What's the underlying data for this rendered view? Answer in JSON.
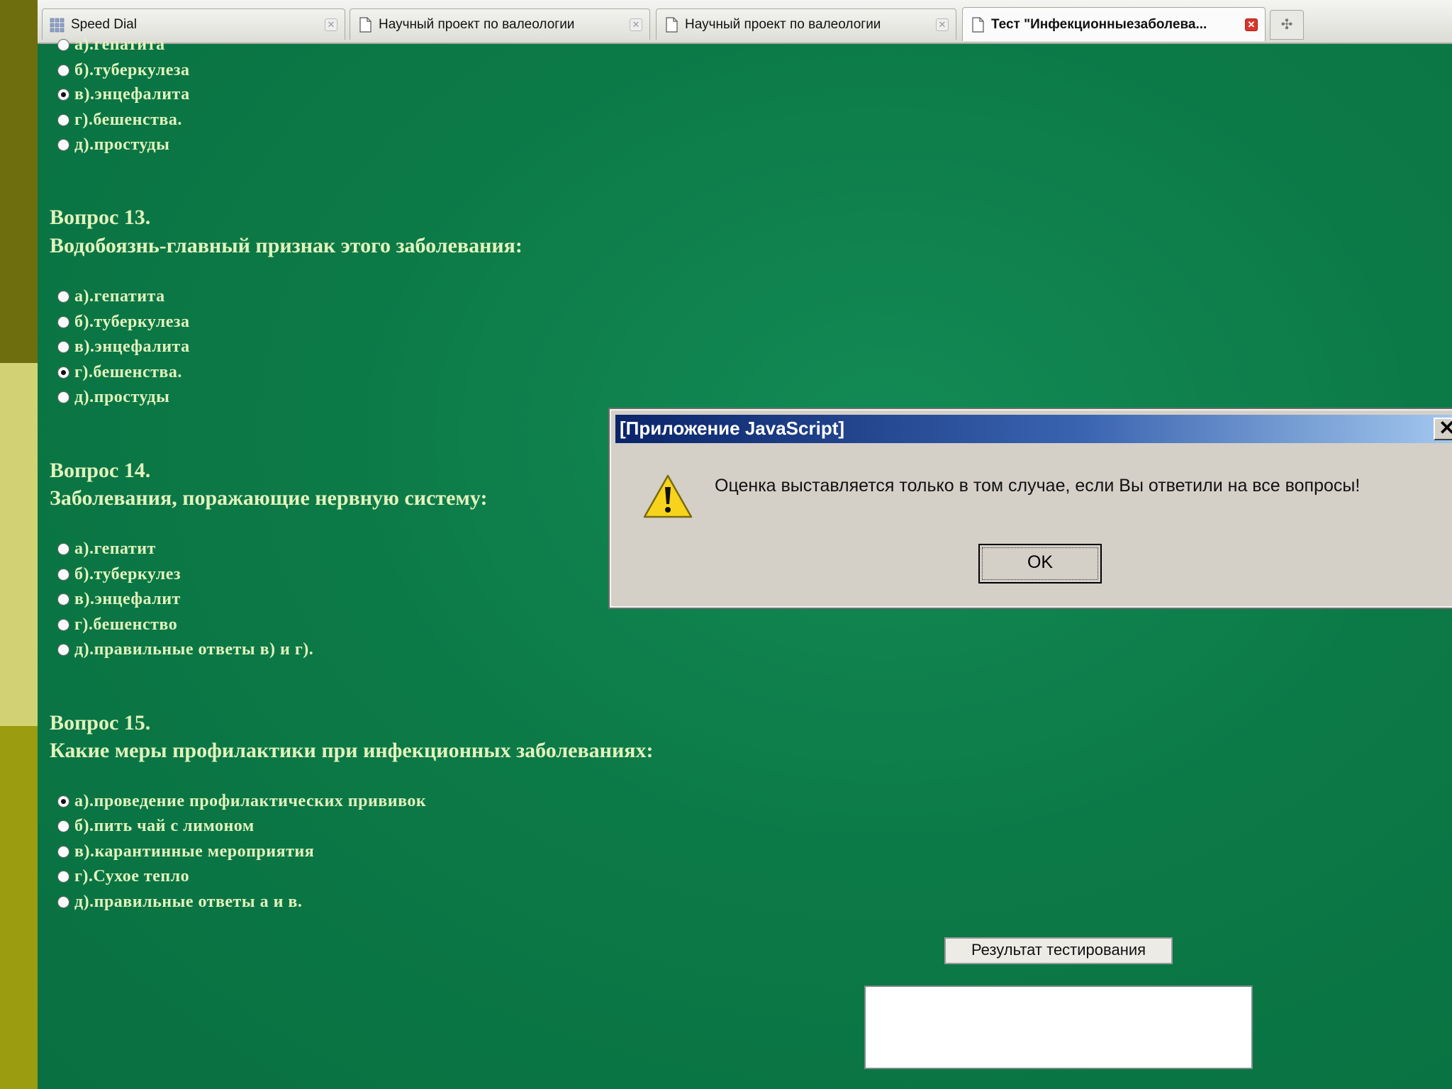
{
  "browser": {
    "tabs": [
      {
        "label": "Speed Dial",
        "icon": "speed-dial-grid-icon",
        "active": false
      },
      {
        "label": "Научный проект по валеологии",
        "icon": "page-icon",
        "active": false
      },
      {
        "label": "Научный проект по валеологии",
        "icon": "page-icon",
        "active": false
      },
      {
        "label": "Тест \"Инфекционныезаболева...",
        "icon": "page-icon",
        "active": true
      }
    ],
    "new_tab_symbol": "✣"
  },
  "questions": {
    "q12": {
      "options": [
        {
          "label": "а).гепатита",
          "checked": false
        },
        {
          "label": "б).туберкулеза",
          "checked": false
        },
        {
          "label": "в).энцефалита",
          "checked": true
        },
        {
          "label": "г).бешенства.",
          "checked": false
        },
        {
          "label": "д).простуды",
          "checked": false
        }
      ]
    },
    "q13": {
      "number": "Вопрос 13.",
      "text": "Водобоязнь-главный признак этого заболевания:",
      "options": [
        {
          "label": "а).гепатита",
          "checked": false
        },
        {
          "label": "б).туберкулеза",
          "checked": false
        },
        {
          "label": "в).энцефалита",
          "checked": false
        },
        {
          "label": "г).бешенства.",
          "checked": true
        },
        {
          "label": "д).простуды",
          "checked": false
        }
      ]
    },
    "q14": {
      "number": "Вопрос 14.",
      "text": "Заболевания, поражающие нервную систему:",
      "options": [
        {
          "label": "а).гепатит",
          "checked": false
        },
        {
          "label": "б).туберкулез",
          "checked": false
        },
        {
          "label": "в).энцефалит",
          "checked": false
        },
        {
          "label": "г).бешенство",
          "checked": false
        },
        {
          "label": "д).правильные ответы в) и г).",
          "checked": false
        }
      ]
    },
    "q15": {
      "number": "Вопрос 15.",
      "text": "Какие меры профилактики при инфекционных заболеваниях:",
      "options": [
        {
          "label": "а).проведение профилактических прививок",
          "checked": true
        },
        {
          "label": "б).пить чай с лимоном",
          "checked": false
        },
        {
          "label": "в).карантинные мероприятия",
          "checked": false
        },
        {
          "label": "г).Сухое тепло",
          "checked": false
        },
        {
          "label": "д).правильные ответы а и в.",
          "checked": false
        }
      ]
    }
  },
  "result": {
    "button_label": "Результат тестирования",
    "output_value": ""
  },
  "dialog": {
    "title": "[Приложение JavaScript]",
    "close_symbol": "✕",
    "icon": "warning-icon",
    "message": "Оценка выставляется только в том случае, если Вы ответили на все вопросы!",
    "ok_label": "OK"
  },
  "colors": {
    "page_background": "#0e7a4a",
    "question_text": "#e2f3bd",
    "dialog_titlebar_start": "#0a246a",
    "dialog_titlebar_end": "#a6caf0",
    "strip_dark": "#6e6e0e",
    "strip_light": "#d2d275",
    "strip_mid": "#9c9c10"
  }
}
